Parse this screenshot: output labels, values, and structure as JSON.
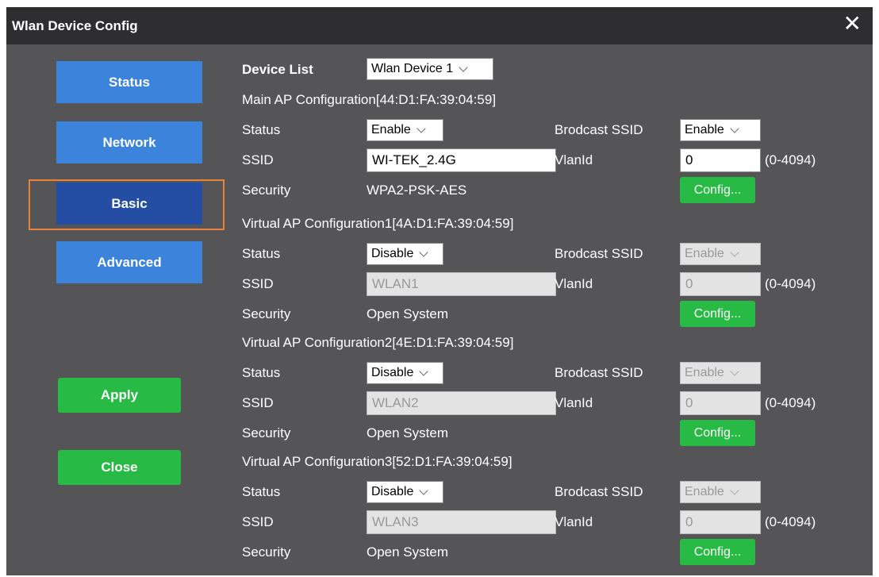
{
  "window": {
    "title": "Wlan Device Config"
  },
  "sidebar": {
    "status": "Status",
    "network": "Network",
    "basic": "Basic",
    "advanced": "Advanced",
    "apply": "Apply",
    "close": "Close"
  },
  "device_list": {
    "label": "Device List",
    "value": "Wlan Device 1"
  },
  "labels": {
    "status": "Status",
    "ssid": "SSID",
    "security": "Security",
    "broadcast": "Brodcast SSID",
    "vlanid": "VlanId",
    "range": "(0-4094)",
    "config": "Config..."
  },
  "sections": [
    {
      "header": "Main AP Configuration[44:D1:FA:39:04:59]",
      "status": "Enable",
      "ssid": "WI-TEK_2.4G",
      "security": "WPA2-PSK-AES",
      "broadcast": "Enable",
      "vlan": "0",
      "disabled": false
    },
    {
      "header": "Virtual AP Configuration1[4A:D1:FA:39:04:59]",
      "status": "Disable",
      "ssid": "WLAN1",
      "security": "Open System",
      "broadcast": "Enable",
      "vlan": "0",
      "disabled": true
    },
    {
      "header": "Virtual AP Configuration2[4E:D1:FA:39:04:59]",
      "status": "Disable",
      "ssid": "WLAN2",
      "security": "Open System",
      "broadcast": "Enable",
      "vlan": "0",
      "disabled": true
    },
    {
      "header": "Virtual AP Configuration3[52:D1:FA:39:04:59]",
      "status": "Disable",
      "ssid": "WLAN3",
      "security": "Open System",
      "broadcast": "Enable",
      "vlan": "0",
      "disabled": true
    }
  ]
}
